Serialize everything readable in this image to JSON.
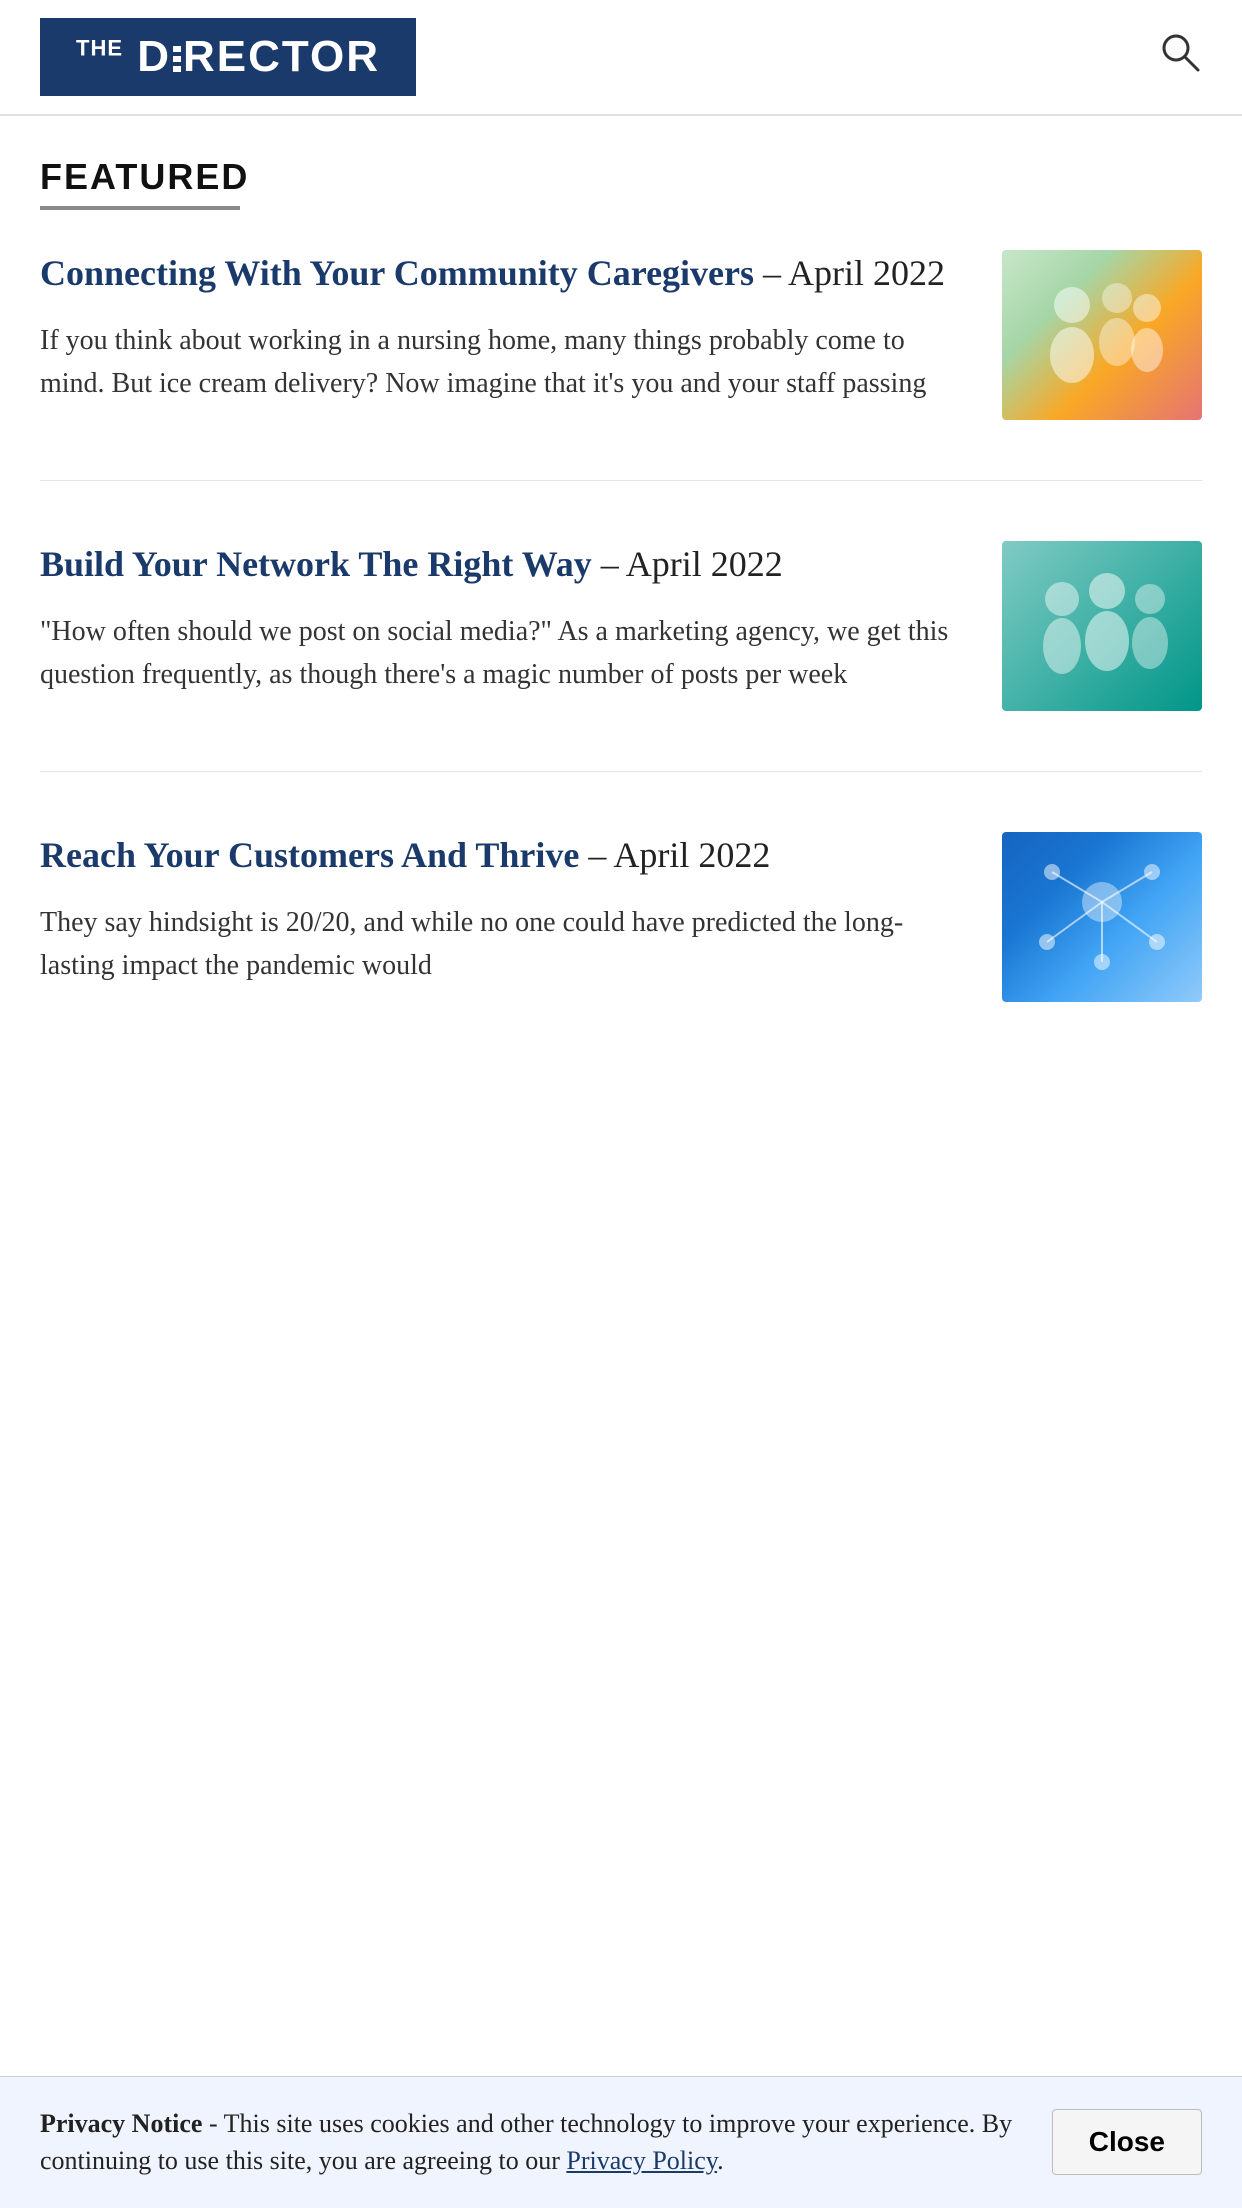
{
  "header": {
    "logo_text": "THE DIRECTOR",
    "search_label": "Search"
  },
  "featured": {
    "section_label": "FEATURED",
    "articles": [
      {
        "id": "article-1",
        "title_link": "Connecting With Your Community Caregivers",
        "title_date": " – April 2022",
        "excerpt": "If you think about working in a nursing home, many things probably come to mind. But ice cream delivery? Now imagine that it's you and your staff passing",
        "image_alt": "Community Caregivers image"
      },
      {
        "id": "article-2",
        "title_link": "Build Your Network The Right Way",
        "title_date": " – April 2022",
        "excerpt": "\"How often should we post on social media?\" As a marketing agency, we get this question frequently, as though there's a magic number of posts per week",
        "image_alt": "Build Your Network image"
      },
      {
        "id": "article-3",
        "title_link": "Reach Your Customers And Thrive",
        "title_date": " – April 2022",
        "excerpt": "They say hindsight is 20/20, and while no one could have predicted the long-lasting impact the pandemic would",
        "image_alt": "Reach Your Customers image"
      }
    ]
  },
  "privacy": {
    "label": "Privacy Notice",
    "text": " - This site uses cookies and other technology to improve your experience. By continuing to use this site, you are agreeing to our ",
    "link_text": "Privacy Policy",
    "end_text": ".",
    "close_label": "Close"
  }
}
